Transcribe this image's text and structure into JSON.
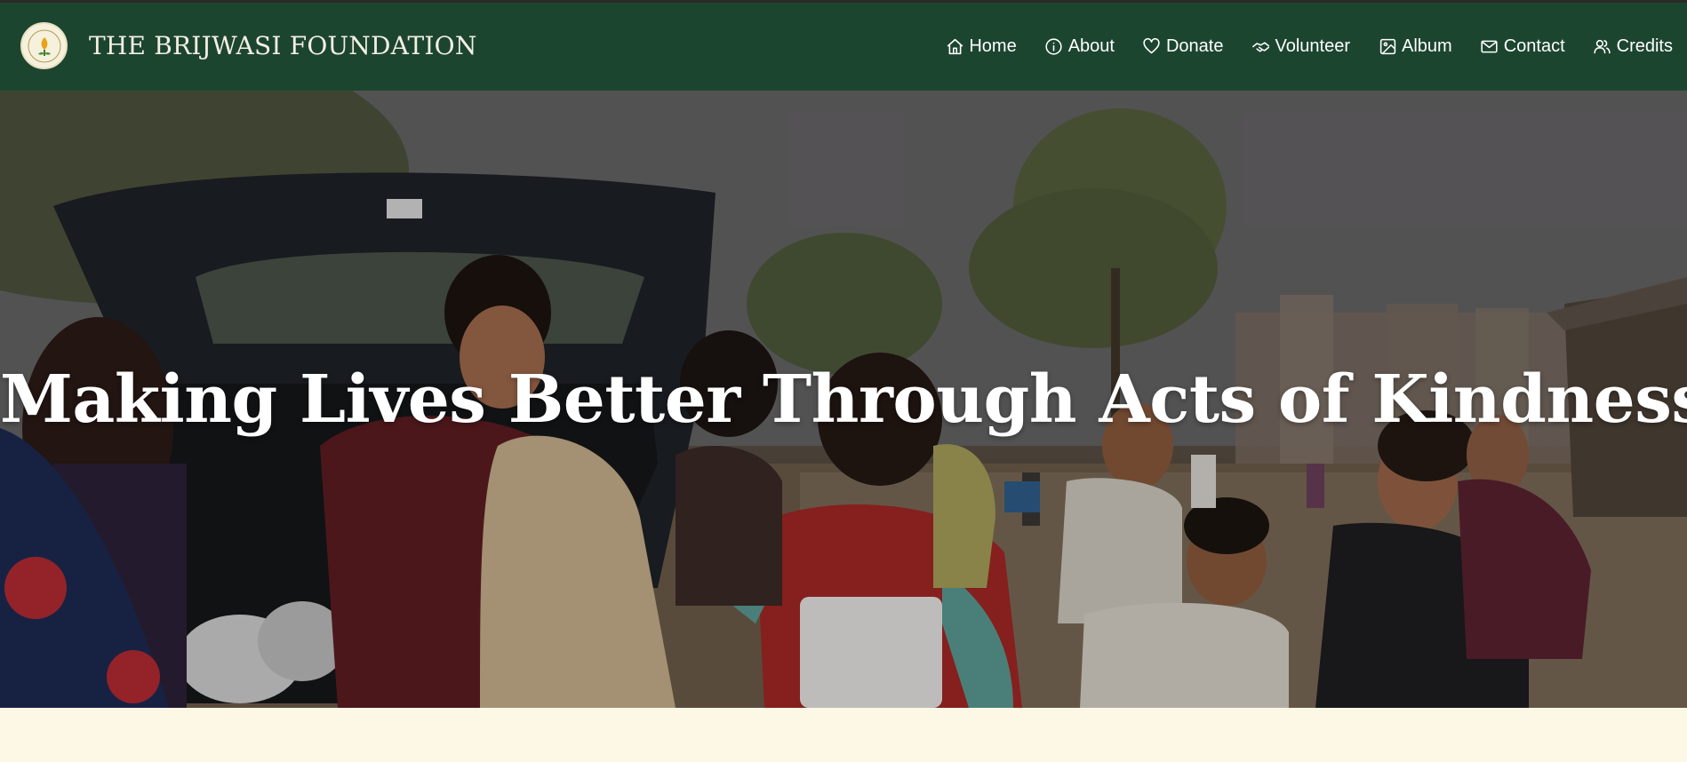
{
  "header": {
    "logo_icon": "foundation-logo-icon",
    "brand": "THE BRIJWASI FOUNDATION",
    "background": "#1c4530"
  },
  "nav": {
    "items": [
      {
        "label": "Home",
        "icon": "home-icon"
      },
      {
        "label": "About",
        "icon": "info-icon"
      },
      {
        "label": "Donate",
        "icon": "heart-icon"
      },
      {
        "label": "Volunteer",
        "icon": "handshake-icon"
      },
      {
        "label": "Album",
        "icon": "image-icon"
      },
      {
        "label": "Contact",
        "icon": "mail-icon"
      },
      {
        "label": "Credits",
        "icon": "users-icon"
      }
    ]
  },
  "hero": {
    "title": "Making Lives Better Through Acts of Kindness",
    "image": "volunteers-distributing-bags-photo"
  },
  "colors": {
    "header_bg": "#1c4530",
    "page_bg": "#fdf8e6",
    "text_light": "#ffffff"
  }
}
